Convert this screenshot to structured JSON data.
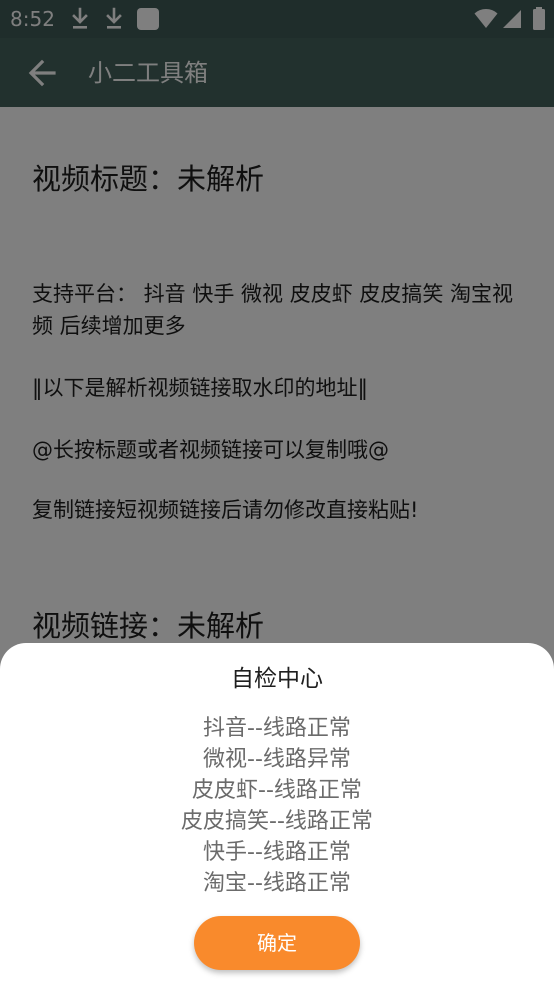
{
  "status_bar": {
    "time": "8:52",
    "icons": [
      "download-icon",
      "download-icon",
      "app-square-icon",
      "wifi-icon",
      "signal-icon",
      "battery-icon"
    ]
  },
  "app_bar": {
    "back_icon": "arrow-back-icon",
    "title": "小二工具箱"
  },
  "content": {
    "video_title": "视频标题：未解析",
    "platforms": "支持平台： 抖音 快手 微视 皮皮虾 皮皮搞笑 淘宝视频 后续增加更多",
    "address_note": "‖以下是解析视频链接取水印的地址‖",
    "copy_tip": "@长按标题或者视频链接可以复制哦@",
    "paste_tip": "复制链接短视频链接后请勿修改直接粘贴!",
    "video_link": "视频链接：未解析"
  },
  "dialog": {
    "title": "自检中心",
    "lines": [
      "抖音--线路正常",
      "微视--线路异常",
      "皮皮虾--线路正常",
      "皮皮搞笑--线路正常",
      "快手--线路正常",
      "淘宝--线路正常"
    ],
    "confirm_label": "确定"
  },
  "colors": {
    "status_bar": "#3f5b56",
    "app_bar": "#44635d",
    "accent": "#f98a2c"
  }
}
